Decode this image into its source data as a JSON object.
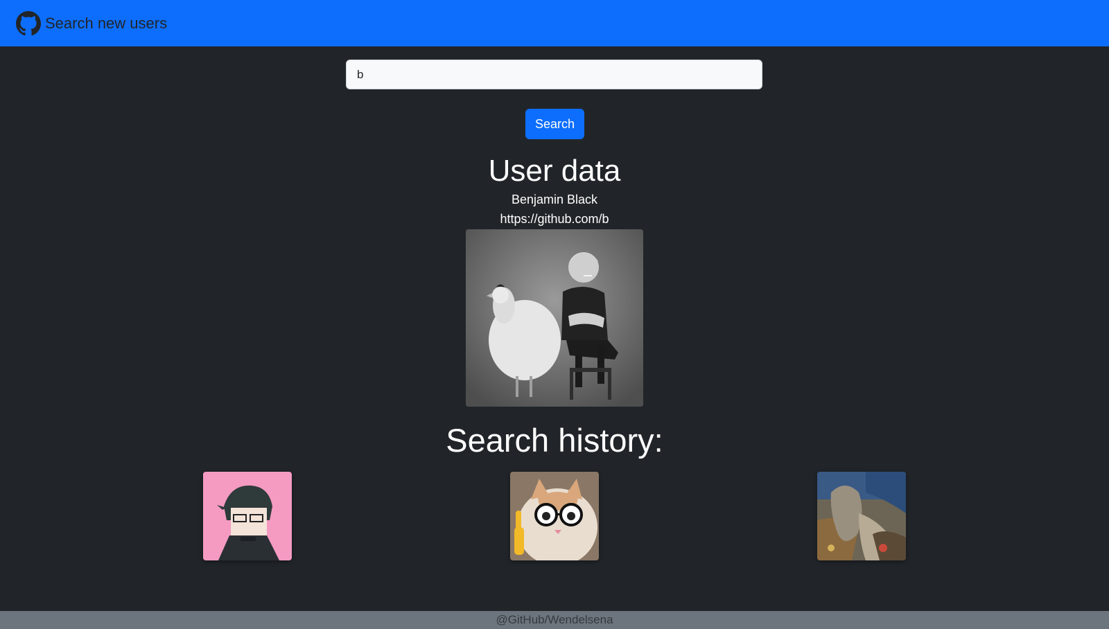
{
  "navbar": {
    "brand_icon": "github-icon",
    "brand_title": "Search new users",
    "background": "#0d6efd"
  },
  "search": {
    "input_value": "b",
    "button_label": "Search"
  },
  "user": {
    "heading": "User data",
    "name": "Benjamin Black",
    "url": "https://github.com/b",
    "avatar": "user-avatar-image"
  },
  "history": {
    "heading": "Search history:",
    "items": [
      {
        "avatar": "pixel-art-avatar"
      },
      {
        "avatar": "cat-with-glasses-avatar"
      },
      {
        "avatar": "painting-avatar"
      }
    ]
  },
  "footer": {
    "text": "@GitHub/Wendelsena"
  },
  "colors": {
    "page_background": "#212529",
    "primary": "#0d6efd",
    "footer_background": "#6c757d"
  }
}
